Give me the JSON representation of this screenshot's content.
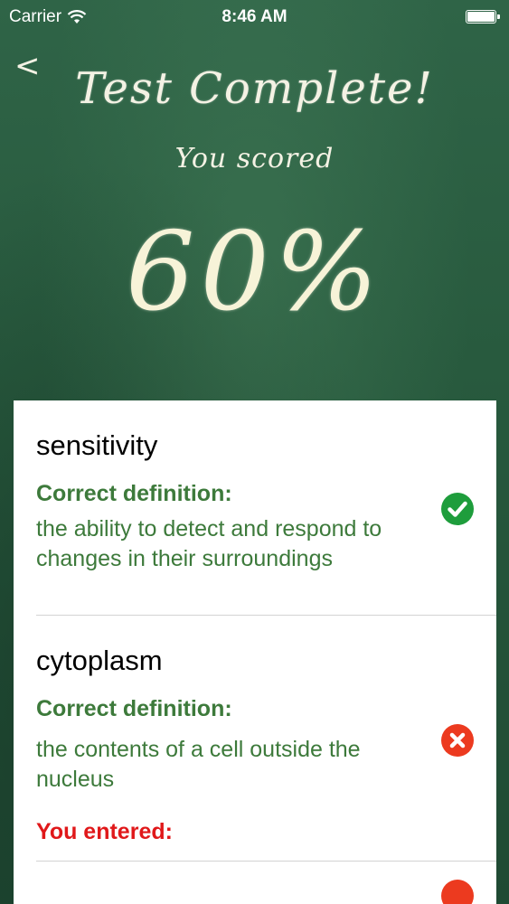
{
  "status_bar": {
    "carrier": "Carrier",
    "time": "8:46 AM",
    "signal": "wifi-icon",
    "battery": "battery-icon"
  },
  "header": {
    "back": "<",
    "title": "Test Complete!",
    "subtitle": "You scored",
    "score": "60%"
  },
  "results": [
    {
      "term": "sensitivity",
      "definition_heading": "Correct definition:",
      "definition": "the ability to detect and respond to changes in their surroundings",
      "status": "correct",
      "icon": "checkmark-icon"
    },
    {
      "term": "cytoplasm",
      "definition_heading": "Correct definition:",
      "definition": "the contents of a cell outside the nucleus",
      "entered_heading": "You entered:",
      "status": "incorrect",
      "icon": "x-icon"
    }
  ],
  "colors": {
    "chalkboard": "#285a3e",
    "correct_green": "#3d7a3b",
    "check_green": "#1e9d3c",
    "wrong_red": "#e0181a",
    "x_red": "#ec3a1f"
  }
}
